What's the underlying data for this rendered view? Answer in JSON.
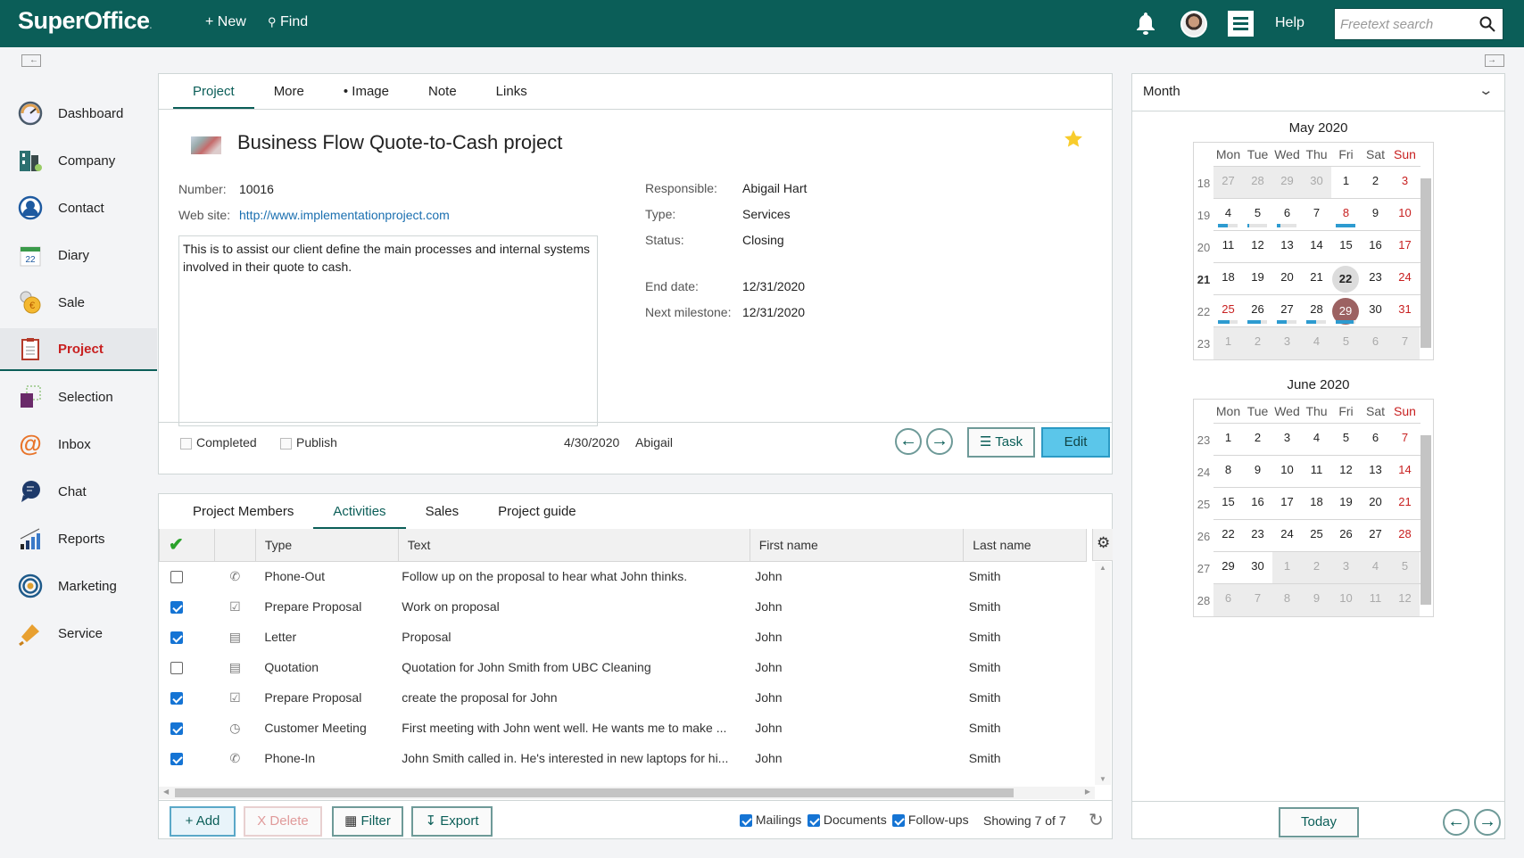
{
  "app": {
    "logo": "SuperOffice",
    "logo_dot": ".",
    "new_label": "+ New",
    "find_label": "Find",
    "help_label": "Help",
    "search_placeholder": "Freetext search"
  },
  "sidebar": {
    "items": [
      {
        "label": "Dashboard",
        "icon": "dashboard-icon"
      },
      {
        "label": "Company",
        "icon": "company-icon"
      },
      {
        "label": "Contact",
        "icon": "contact-icon"
      },
      {
        "label": "Diary",
        "icon": "diary-icon",
        "icon_text": "22"
      },
      {
        "label": "Sale",
        "icon": "sale-icon"
      },
      {
        "label": "Project",
        "icon": "project-icon",
        "active": true
      },
      {
        "label": "Selection",
        "icon": "selection-icon"
      },
      {
        "label": "Inbox",
        "icon": "inbox-icon"
      },
      {
        "label": "Chat",
        "icon": "chat-icon"
      },
      {
        "label": "Reports",
        "icon": "reports-icon"
      },
      {
        "label": "Marketing",
        "icon": "marketing-icon"
      },
      {
        "label": "Service",
        "icon": "service-icon"
      }
    ]
  },
  "project": {
    "tabs": [
      "Project",
      "More",
      "• Image",
      "Note",
      "Links"
    ],
    "active_tab": "Project",
    "title": "Business Flow Quote-to-Cash project",
    "favorite": true,
    "fields_left": [
      {
        "label": "Number:",
        "value": "10016"
      },
      {
        "label": "Web site:",
        "value": "http://www.implementationproject.com"
      }
    ],
    "fields_right": [
      {
        "label": "Responsible:",
        "value": "Abigail Hart"
      },
      {
        "label": "Type:",
        "value": "Services"
      },
      {
        "label": "Status:",
        "value": "Closing"
      },
      {
        "label": "End date:",
        "value": "12/31/2020"
      },
      {
        "label": "Next milestone:",
        "value": "12/31/2020"
      }
    ],
    "description": "This is to assist our client define the main processes and internal systems involved in their quote to cash.",
    "completed_label": "Completed",
    "completed": false,
    "publish_label": "Publish",
    "publish": false,
    "updated_date": "4/30/2020",
    "updated_by": "Abigail",
    "task_label": "Task",
    "edit_label": "Edit"
  },
  "activities": {
    "tabs": [
      "Project Members",
      "Activities",
      "Sales",
      "Project guide"
    ],
    "active_tab": "Activities",
    "columns": [
      "",
      "",
      "Type",
      "Text",
      "First name",
      "Last name"
    ],
    "rows": [
      {
        "checked": false,
        "icon": "phone-icon",
        "type": "Phone-Out",
        "text": "Follow up on the proposal to hear what John thinks.",
        "first": "John",
        "last": "Smith"
      },
      {
        "checked": true,
        "icon": "task-check-icon",
        "type": "Prepare Proposal",
        "text": "Work on proposal",
        "first": "John",
        "last": "Smith"
      },
      {
        "checked": true,
        "icon": "document-icon",
        "type": "Letter",
        "text": "Proposal",
        "first": "John",
        "last": "Smith"
      },
      {
        "checked": false,
        "icon": "document-icon",
        "type": "Quotation",
        "text": "Quotation for John Smith from UBC Cleaning",
        "first": "John",
        "last": "Smith"
      },
      {
        "checked": true,
        "icon": "task-check-icon",
        "type": "Prepare Proposal",
        "text": "create the proposal for John",
        "first": "John",
        "last": "Smith"
      },
      {
        "checked": true,
        "icon": "clock-icon",
        "type": "Customer Meeting",
        "text": "First meeting with John went well. He wants me to make ...",
        "first": "John",
        "last": "Smith"
      },
      {
        "checked": true,
        "icon": "phone-icon",
        "type": "Phone-In",
        "text": "John Smith called in. He's interested in new laptops for hi...",
        "first": "John",
        "last": "Smith"
      }
    ],
    "footer": {
      "add_label": "+ Add",
      "delete_label": "X Delete",
      "filter_label": "Filter",
      "export_label": "Export",
      "mailings_label": "Mailings",
      "mailings": true,
      "documents_label": "Documents",
      "documents": true,
      "followups_label": "Follow-ups",
      "followups": true,
      "showing": "Showing 7 of 7"
    }
  },
  "calendar": {
    "view_label": "Month",
    "today_label": "Today",
    "weekdays": [
      "Mon",
      "Tue",
      "Wed",
      "Thu",
      "Fri",
      "Sat",
      "Sun"
    ],
    "today": "22",
    "selected": "29",
    "months": [
      {
        "title": "May 2020",
        "weeks": [
          {
            "wk": "18",
            "days": [
              "27",
              "28",
              "29",
              "30",
              "1",
              "2",
              "3"
            ],
            "other": [
              0,
              1,
              2,
              3
            ]
          },
          {
            "wk": "19",
            "days": [
              "4",
              "5",
              "6",
              "7",
              "8",
              "9",
              "10"
            ],
            "other": []
          },
          {
            "wk": "20",
            "days": [
              "11",
              "12",
              "13",
              "14",
              "15",
              "16",
              "17"
            ],
            "other": []
          },
          {
            "wk": "21",
            "days": [
              "18",
              "19",
              "20",
              "21",
              "22",
              "23",
              "24"
            ],
            "other": []
          },
          {
            "wk": "22",
            "days": [
              "25",
              "26",
              "27",
              "28",
              "29",
              "30",
              "31"
            ],
            "other": []
          },
          {
            "wk": "23",
            "days": [
              "1",
              "2",
              "3",
              "4",
              "5",
              "6",
              "7"
            ],
            "other": [
              0,
              1,
              2,
              3,
              4,
              5,
              6
            ]
          }
        ],
        "red_days": [
          "3",
          "8",
          "10",
          "17",
          "24",
          "25",
          "31"
        ],
        "load_bars": {
          "4": 0.5,
          "5": 0.1,
          "6": 0.2,
          "8": 1.0,
          "25": 0.6,
          "26": 0.7,
          "27": 0.5,
          "28": 0.5,
          "29": 0.9
        }
      },
      {
        "title": "June 2020",
        "weeks": [
          {
            "wk": "23",
            "days": [
              "1",
              "2",
              "3",
              "4",
              "5",
              "6",
              "7"
            ],
            "other": []
          },
          {
            "wk": "24",
            "days": [
              "8",
              "9",
              "10",
              "11",
              "12",
              "13",
              "14"
            ],
            "other": []
          },
          {
            "wk": "25",
            "days": [
              "15",
              "16",
              "17",
              "18",
              "19",
              "20",
              "21"
            ],
            "other": []
          },
          {
            "wk": "26",
            "days": [
              "22",
              "23",
              "24",
              "25",
              "26",
              "27",
              "28"
            ],
            "other": []
          },
          {
            "wk": "27",
            "days": [
              "29",
              "30",
              "1",
              "2",
              "3",
              "4",
              "5"
            ],
            "other": [
              2,
              3,
              4,
              5,
              6
            ]
          },
          {
            "wk": "28",
            "days": [
              "6",
              "7",
              "8",
              "9",
              "10",
              "11",
              "12"
            ],
            "other": [
              0,
              1,
              2,
              3,
              4,
              5,
              6
            ]
          }
        ],
        "red_days": [
          "7",
          "14",
          "21",
          "28"
        ],
        "load_bars": {}
      }
    ]
  },
  "colors": {
    "brand": "#0b5e58",
    "accent": "#5bc6ea",
    "active_nav": "#c82020",
    "sunday": "#c82020",
    "selected_day": "#9c6262"
  }
}
